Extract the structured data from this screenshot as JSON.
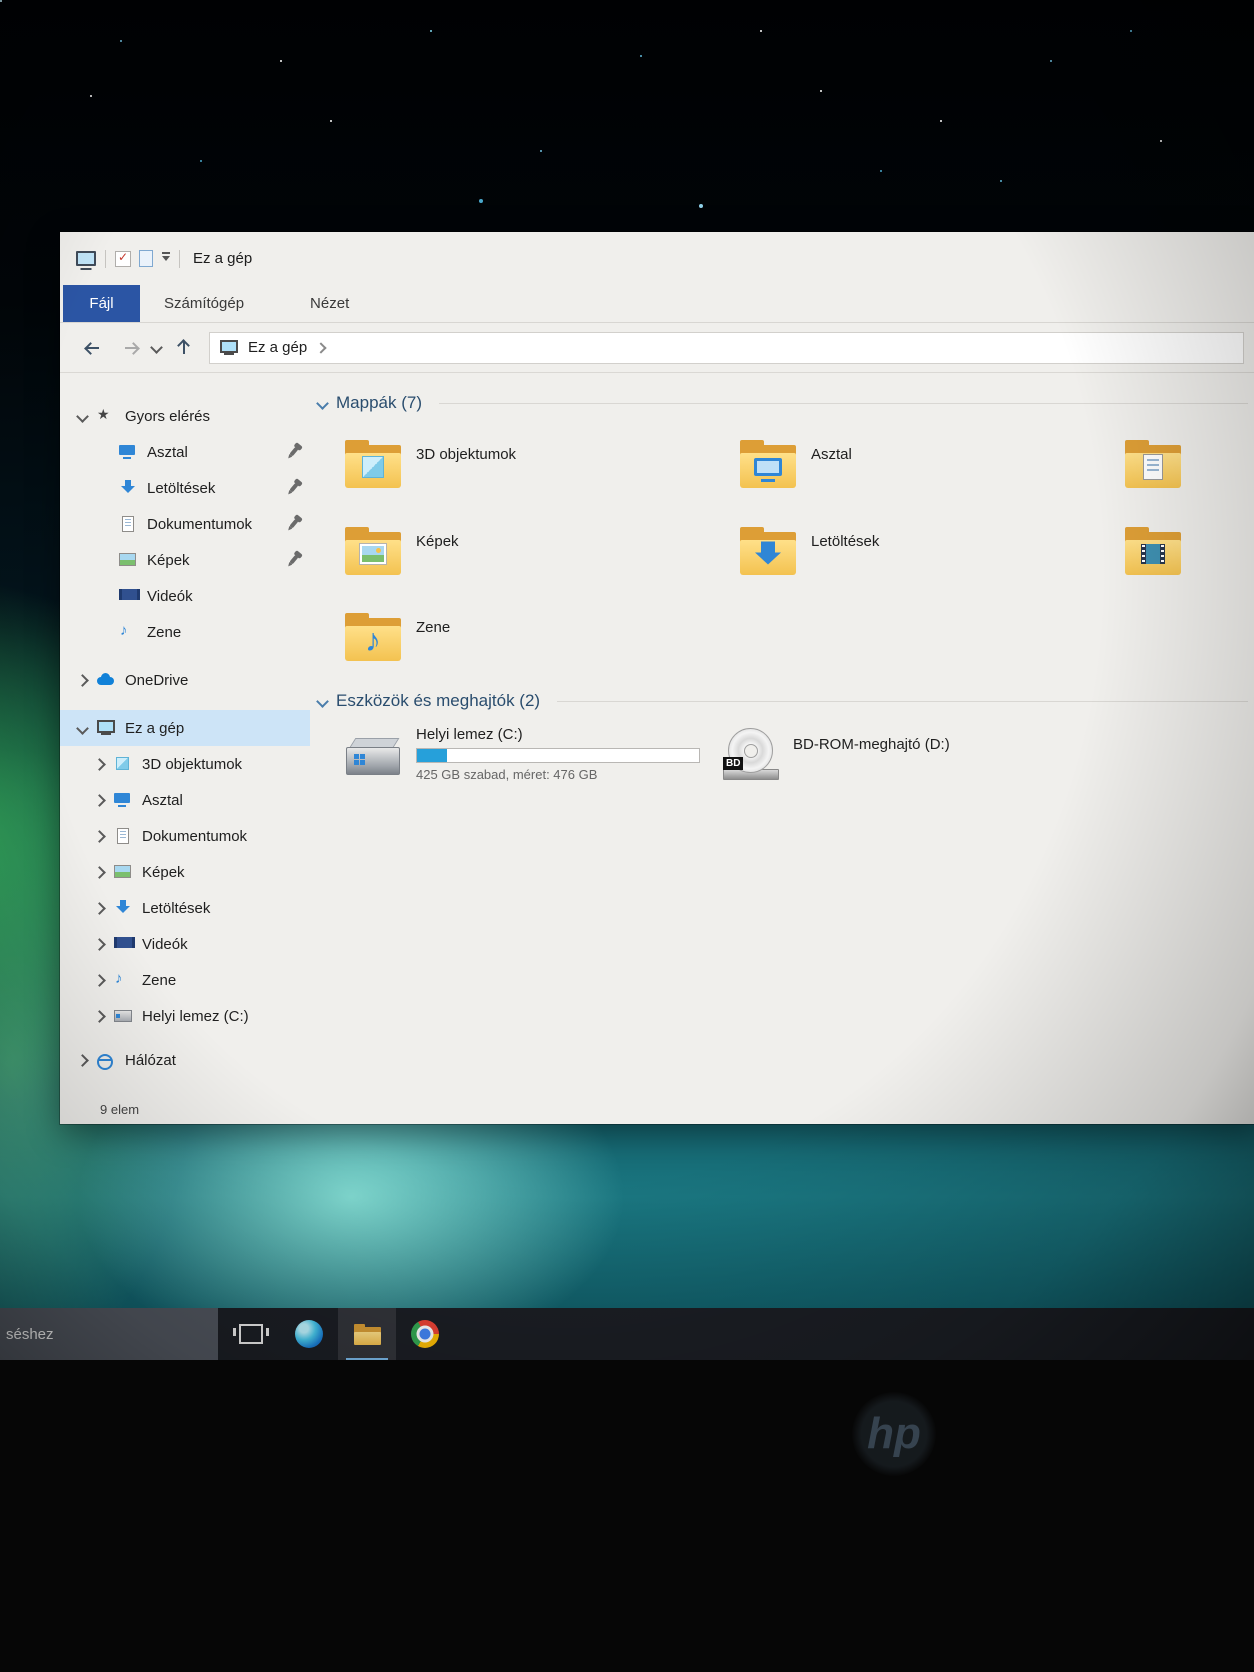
{
  "window": {
    "title": "Ez a gép",
    "tabs": {
      "file": "Fájl",
      "computer": "Számítógép",
      "view": "Nézet"
    },
    "address": {
      "location": "Ez a gép"
    },
    "status_text": "9 elem"
  },
  "sidebar": {
    "quick_access": {
      "label": "Gyors elérés",
      "items": [
        {
          "label": "Asztal",
          "pinned": true
        },
        {
          "label": "Letöltések",
          "pinned": true
        },
        {
          "label": "Dokumentumok",
          "pinned": true
        },
        {
          "label": "Képek",
          "pinned": true
        },
        {
          "label": "Videók",
          "pinned": false
        },
        {
          "label": "Zene",
          "pinned": false
        }
      ]
    },
    "onedrive": {
      "label": "OneDrive"
    },
    "this_pc": {
      "label": "Ez a gép",
      "items": [
        {
          "label": "3D objektumok"
        },
        {
          "label": "Asztal"
        },
        {
          "label": "Dokumentumok"
        },
        {
          "label": "Képek"
        },
        {
          "label": "Letöltések"
        },
        {
          "label": "Videók"
        },
        {
          "label": "Zene"
        },
        {
          "label": "Helyi lemez (C:)"
        }
      ]
    },
    "network": {
      "label": "Hálózat"
    }
  },
  "main": {
    "folders_header": "Mappák (7)",
    "folders": [
      {
        "name": "3D objektumok"
      },
      {
        "name": "Asztal"
      },
      {
        "name": ""
      },
      {
        "name": "Képek"
      },
      {
        "name": "Letöltések"
      },
      {
        "name": ""
      },
      {
        "name": "Zene"
      }
    ],
    "devices_header": "Eszközök és meghajtók (2)",
    "drives": [
      {
        "name": "Helyi lemez (C:)",
        "detail": "425 GB szabad, méret: 476 GB",
        "bar_style": "width:10.7%"
      },
      {
        "name": "BD-ROM-meghajtó (D:)",
        "badge": "BD"
      }
    ]
  },
  "taskbar": {
    "search_text": "séshez"
  },
  "device": {
    "logo": "hp"
  },
  "colors": {
    "accent_blue": "#2f86d6",
    "folder_yellow": "#f3c250",
    "capacity_fill": "#26a0da",
    "tab_active": "#2b55a4"
  }
}
